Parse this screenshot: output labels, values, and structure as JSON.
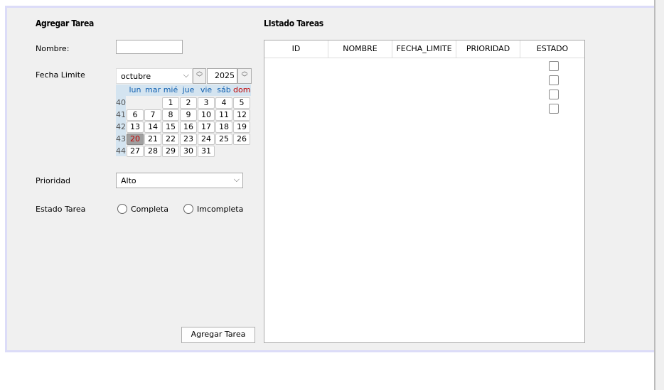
{
  "form": {
    "title": "Agregar Tarea",
    "name_label": "Nombre:",
    "name_value": "",
    "date_label": "Fecha Limite",
    "priority_label": "Prioridad",
    "priority_value": "Alto",
    "status_label": "Estado Tarea",
    "status_options": [
      "Completa",
      "Imcompleta"
    ],
    "submit_label": "Agregar Tarea"
  },
  "calendar": {
    "month": "octubre",
    "year": "2025",
    "weekdays": [
      "lun",
      "mar",
      "mié",
      "jue",
      "vie",
      "sáb",
      "dom"
    ],
    "weeks": [
      {
        "n": "40",
        "days": [
          "",
          "",
          "1",
          "2",
          "3",
          "4",
          "5"
        ]
      },
      {
        "n": "41",
        "days": [
          "6",
          "7",
          "8",
          "9",
          "10",
          "11",
          "12"
        ]
      },
      {
        "n": "42",
        "days": [
          "13",
          "14",
          "15",
          "16",
          "17",
          "18",
          "19"
        ]
      },
      {
        "n": "43",
        "days": [
          "20",
          "21",
          "22",
          "23",
          "24",
          "25",
          "26"
        ]
      },
      {
        "n": "44",
        "days": [
          "27",
          "28",
          "29",
          "30",
          "31",
          "",
          ""
        ]
      }
    ],
    "selected": "20",
    "sunday_color": "#c00000",
    "weekday_color": "#1060b0"
  },
  "list": {
    "title": "LIstado Tareas",
    "columns": [
      "ID",
      "NOMBRE",
      "FECHA_LIMITE",
      "PRIORIDAD",
      "ESTADO"
    ],
    "rows": 4
  }
}
